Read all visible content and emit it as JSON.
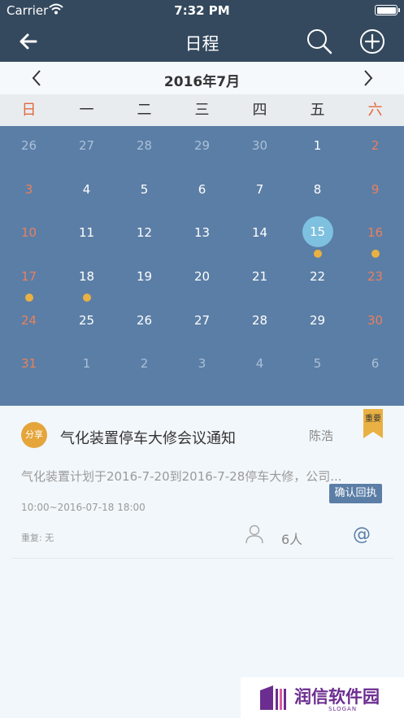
{
  "status": {
    "carrier": "Carrier",
    "time": "7:32 PM"
  },
  "nav": {
    "title": "日程"
  },
  "month": {
    "label": "2016年7月"
  },
  "weekdays": [
    "日",
    "一",
    "二",
    "三",
    "四",
    "五",
    "六"
  ],
  "calendar": {
    "weeks": [
      [
        {
          "d": "26",
          "o": true
        },
        {
          "d": "27",
          "o": true
        },
        {
          "d": "28",
          "o": true
        },
        {
          "d": "29",
          "o": true
        },
        {
          "d": "30",
          "o": true
        },
        {
          "d": "1"
        },
        {
          "d": "2"
        }
      ],
      [
        {
          "d": "3"
        },
        {
          "d": "4"
        },
        {
          "d": "5"
        },
        {
          "d": "6"
        },
        {
          "d": "7"
        },
        {
          "d": "8"
        },
        {
          "d": "9"
        }
      ],
      [
        {
          "d": "10"
        },
        {
          "d": "11"
        },
        {
          "d": "12"
        },
        {
          "d": "13"
        },
        {
          "d": "14"
        },
        {
          "d": "15",
          "today": true,
          "dot": true
        },
        {
          "d": "16",
          "dot": true
        }
      ],
      [
        {
          "d": "17",
          "dot": true
        },
        {
          "d": "18",
          "dot": true
        },
        {
          "d": "19"
        },
        {
          "d": "20"
        },
        {
          "d": "21"
        },
        {
          "d": "22"
        },
        {
          "d": "23"
        }
      ],
      [
        {
          "d": "24"
        },
        {
          "d": "25"
        },
        {
          "d": "26"
        },
        {
          "d": "27"
        },
        {
          "d": "28"
        },
        {
          "d": "29"
        },
        {
          "d": "30"
        }
      ],
      [
        {
          "d": "31"
        },
        {
          "d": "1",
          "o": true
        },
        {
          "d": "2",
          "o": true
        },
        {
          "d": "3",
          "o": true
        },
        {
          "d": "4",
          "o": true
        },
        {
          "d": "5",
          "o": true
        },
        {
          "d": "6",
          "o": true
        }
      ]
    ]
  },
  "event": {
    "share_tag": "分享",
    "title": "气化装置停车大修会议通知",
    "author": "陈浩",
    "important_label": "重要",
    "description": "气化装置计划于2016-7-20到2016-7-28停车大修，公司...",
    "confirm_label": "确认回执",
    "time": "10:00~2016-07-18 18:00",
    "repeat": "重复: 无",
    "attendees": "6人",
    "at_symbol": "@"
  },
  "watermark": {
    "text": "润信软件园",
    "slogan": "SLOGAN"
  },
  "colors": {
    "header": "#34495e",
    "calendar": "#5b7ea6",
    "weekend": "#e16a3d",
    "dot": "#e9b143",
    "today": "#7ec0e0",
    "share": "#e5a53a",
    "brand": "#6b2d8f"
  }
}
